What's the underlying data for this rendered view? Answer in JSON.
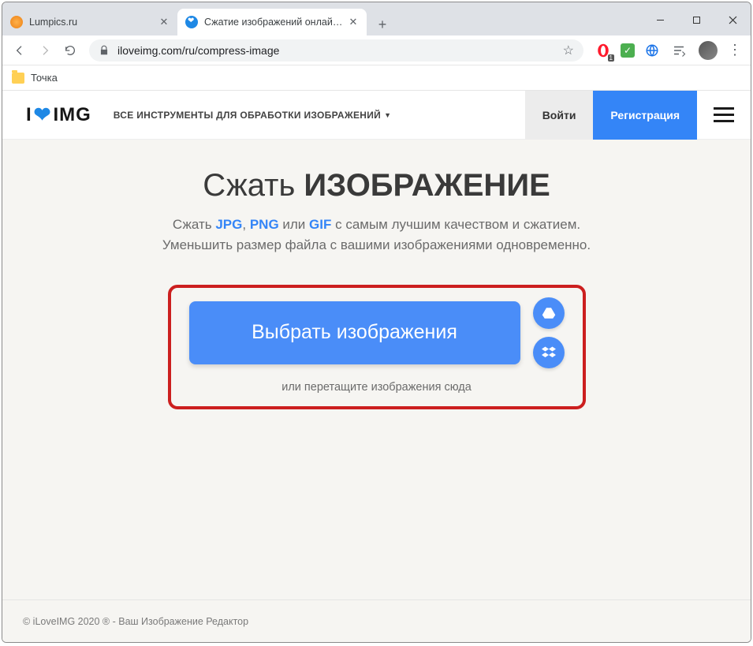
{
  "browser": {
    "tabs": [
      {
        "title": "Lumpics.ru"
      },
      {
        "title": "Сжатие изображений онлайн H"
      }
    ],
    "url": "iloveimg.com/ru/compress-image",
    "bookmark": "Точка",
    "ext_opera_badge": "1"
  },
  "site": {
    "logo": {
      "i": "I",
      "img": "IMG"
    },
    "tools_label": "ВСЕ ИНСТРУМЕНТЫ ДЛЯ ОБРАБОТКИ ИЗОБРАЖЕНИЙ",
    "login": "Войти",
    "register": "Регистрация"
  },
  "hero": {
    "h1_light": "Сжать ",
    "h1_bold": "ИЗОБРАЖЕНИЕ",
    "desc_pre": "Сжать ",
    "jpg": "JPG",
    "comma": ", ",
    "png": "PNG",
    "or": " или ",
    "gif": "GIF",
    "desc_post": " с самым лучшим качеством и сжатием.",
    "desc_line2": "Уменьшить размер файла с вашими изображениями одновременно.",
    "select_btn": "Выбрать изображения",
    "drag_hint": "или перетащите изображения сюда"
  },
  "footer": {
    "text": "© iLoveIMG 2020 ® - Ваш Изображение Редактор"
  }
}
